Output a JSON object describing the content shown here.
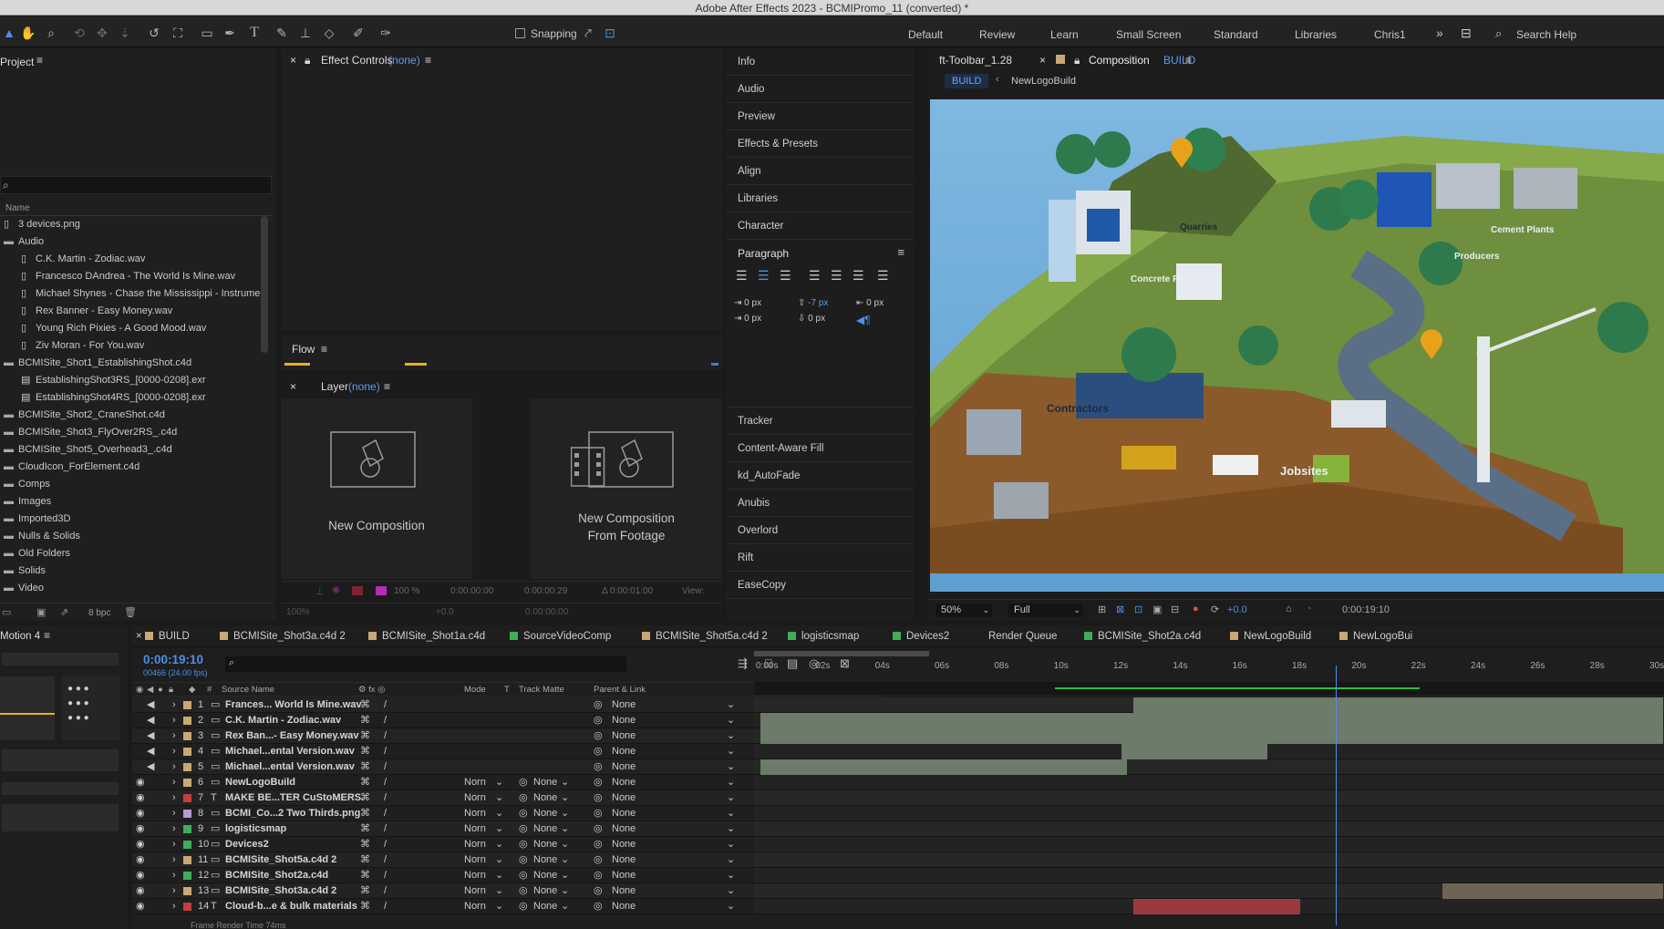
{
  "app": {
    "title": "Adobe After Effects 2023 - BCMIPromo_11 (converted) *"
  },
  "toolbar": {
    "snapping": "Snapping",
    "workspaces": [
      "Default",
      "Review",
      "Learn",
      "Small Screen",
      "Standard",
      "Libraries",
      "Chris1"
    ],
    "search_help": "Search Help",
    "tools": [
      "selection-arrow",
      "hand",
      "zoom",
      "orbit",
      "move",
      "dolly",
      "rotate",
      "anchor",
      "rectangle",
      "pen",
      "type",
      "brush",
      "clone-stamp",
      "eraser",
      "roto-brush",
      "puppet-pin"
    ]
  },
  "project": {
    "title": "Project",
    "name_header": "Name",
    "bpc": "8 bpc",
    "items": [
      {
        "label": "3 devices.png",
        "kind": "file",
        "indent": 0
      },
      {
        "label": "Audio",
        "kind": "folder",
        "indent": 0
      },
      {
        "label": "C.K. Martin - Zodiac.wav",
        "kind": "file",
        "indent": 1
      },
      {
        "label": "Francesco DAndrea - The World Is Mine.wav",
        "kind": "file",
        "indent": 1
      },
      {
        "label": "Michael Shynes - Chase the Mississippi - Instrumen",
        "kind": "file",
        "indent": 1
      },
      {
        "label": "Rex Banner - Easy Money.wav",
        "kind": "file",
        "indent": 1
      },
      {
        "label": "Young Rich Pixies - A Good Mood.wav",
        "kind": "file",
        "indent": 1
      },
      {
        "label": "Ziv Moran - For You.wav",
        "kind": "file",
        "indent": 1
      },
      {
        "label": "BCMISite_Shot1_EstablishingShot.c4d",
        "kind": "folder",
        "indent": 0
      },
      {
        "label": "EstablishingShot3RS_[0000-0208].exr",
        "kind": "seq",
        "indent": 1
      },
      {
        "label": "EstablishingShot4RS_[0000-0208].exr",
        "kind": "seq",
        "indent": 1
      },
      {
        "label": "BCMISite_Shot2_CraneShot.c4d",
        "kind": "folder",
        "indent": 0
      },
      {
        "label": "BCMISite_Shot3_FlyOver2RS_.c4d",
        "kind": "folder",
        "indent": 0
      },
      {
        "label": "BCMISite_Shot5_Overhead3_.c4d",
        "kind": "folder",
        "indent": 0
      },
      {
        "label": "CloudIcon_ForElement.c4d",
        "kind": "folder",
        "indent": 0
      },
      {
        "label": "Comps",
        "kind": "folder",
        "indent": 0
      },
      {
        "label": "Images",
        "kind": "folder",
        "indent": 0
      },
      {
        "label": "Imported3D",
        "kind": "folder",
        "indent": 0
      },
      {
        "label": "Nulls & Solids",
        "kind": "folder",
        "indent": 0
      },
      {
        "label": "Old Folders",
        "kind": "folder",
        "indent": 0
      },
      {
        "label": "Solids",
        "kind": "folder",
        "indent": 0
      },
      {
        "label": "Video",
        "kind": "folder",
        "indent": 0
      }
    ]
  },
  "effect_controls": {
    "title": "Effect Controls",
    "target": "(none)"
  },
  "flow": {
    "title": "Flow"
  },
  "layer_panel": {
    "title": "Layer",
    "target": "(none)",
    "new_comp": "New Composition",
    "new_comp_footage_1": "New Composition",
    "new_comp_footage_2": "From Footage",
    "zoom": "100 %",
    "time_a": "0:00:00:00",
    "time_b": "0:00:00:29",
    "delta": "Δ 0:00:01:00",
    "view": "View:",
    "zoom2": "100%",
    "exposure": "+0.0",
    "time_c": "0:00:00:00"
  },
  "right_panels": {
    "items_top": [
      "Info",
      "Audio",
      "Preview",
      "Effects & Presets",
      "Align",
      "Libraries",
      "Character"
    ],
    "paragraph": {
      "title": "Paragraph",
      "v1": "0 px",
      "v2": "-7 px",
      "v3": "0 px",
      "v4": "0 px",
      "v5": "0 px"
    },
    "items_bottom": [
      "Tracker",
      "Content-Aware Fill",
      "kd_AutoFade",
      "Anubis",
      "Overlord",
      "Rift",
      "EaseCopy"
    ]
  },
  "composition": {
    "tab_left": "ft-Toolbar_1.28",
    "tab_label": "Composition",
    "tab_name": "BUILD",
    "crumb_active": "BUILD",
    "crumb_next": "NewLogoBuild",
    "zoom": "50%",
    "resolution": "Full",
    "exposure": "+0.0",
    "time": "0:00:19:10",
    "scene_labels": [
      "Quarries",
      "Cement Plants",
      "Producers",
      "Concrete Plants",
      "Contractors",
      "Jobsites"
    ]
  },
  "timeline": {
    "tabs": [
      {
        "label": "BUILD",
        "color": "#c9a873"
      },
      {
        "label": "BCMISite_Shot3a.c4d 2",
        "color": "#c9a873"
      },
      {
        "label": "BCMISite_Shot1a.c4d",
        "color": "#c9a873"
      },
      {
        "label": "SourceVideoComp",
        "color": "#3fae5a"
      },
      {
        "label": "BCMISite_Shot5a.c4d 2",
        "color": "#c9a873"
      },
      {
        "label": "logisticsmap",
        "color": "#3fae5a"
      },
      {
        "label": "Devices2",
        "color": "#3fae5a"
      },
      {
        "label": "Render Queue",
        "color": ""
      },
      {
        "label": "BCMISite_Shot2a.c4d",
        "color": "#3fae5a"
      },
      {
        "label": "NewLogoBuild",
        "color": "#c9a873"
      },
      {
        "label": "NewLogoBui",
        "color": "#c9a873"
      }
    ],
    "motion_panel": "Motion 4",
    "timecode": "0:00:19:10",
    "frame_info": "00466 (24.00 fps)",
    "headers": {
      "source": "Source Name",
      "mode": "Mode",
      "t": "T",
      "matte": "Track Matte",
      "parent": "Parent & Link",
      "num": "#"
    },
    "ruler": [
      "0:00s",
      "02s",
      "04s",
      "06s",
      "08s",
      "10s",
      "12s",
      "14s",
      "16s",
      "18s",
      "20s",
      "22s",
      "24s",
      "26s",
      "28s",
      "30s"
    ],
    "playhead_seconds": 19.42,
    "duration_seconds": 30,
    "layers": [
      {
        "num": "1",
        "name": "Frances... World Is Mine.wav",
        "color": "#c9a873",
        "type": "audio",
        "mode": "",
        "matte": "",
        "parent": "None",
        "bar_start": 12.6,
        "bar_end": 30.4,
        "bar_color": "#6d7b6a"
      },
      {
        "num": "2",
        "name": "C.K. Martin - Zodiac.wav",
        "color": "#c9a873",
        "type": "audio",
        "mode": "",
        "matte": "",
        "parent": "None",
        "bar_start": 0.1,
        "bar_end": 30.4,
        "bar_color": "#6d7b6a"
      },
      {
        "num": "3",
        "name": "Rex Ban...- Easy Money.wav",
        "color": "#c9a873",
        "type": "audio",
        "mode": "",
        "matte": "",
        "parent": "None",
        "bar_start": 0.1,
        "bar_end": 30.4,
        "bar_color": "#6d7b6a"
      },
      {
        "num": "4",
        "name": "Michael...ental Version.wav",
        "color": "#c9a873",
        "type": "audio",
        "mode": "",
        "matte": "",
        "parent": "None",
        "bar_start": 12.2,
        "bar_end": 17.1,
        "bar_color": "#6d7b6a"
      },
      {
        "num": "5",
        "name": "Michael...ental Version.wav",
        "color": "#c9a873",
        "type": "audio",
        "mode": "",
        "matte": "",
        "parent": "None",
        "bar_start": 0.1,
        "bar_end": 12.4,
        "bar_color": "#6d7b6a"
      },
      {
        "num": "6",
        "name": "NewLogoBuild",
        "color": "#c9a873",
        "type": "comp",
        "mode": "Norn",
        "matte": "None",
        "parent": "None",
        "bar_start": 0,
        "bar_end": 0,
        "bar_color": ""
      },
      {
        "num": "7",
        "name": "MAKE BE...TER CuStoMERS.",
        "color": "#c04040",
        "type": "text",
        "mode": "Norn",
        "matte": "None",
        "parent": "None",
        "bar_start": 0,
        "bar_end": 0,
        "bar_color": ""
      },
      {
        "num": "8",
        "name": "BCMI_Co...2 Two Thirds.png",
        "color": "#b59ad2",
        "type": "image",
        "mode": "Norn",
        "matte": "None",
        "parent": "None",
        "bar_start": 0,
        "bar_end": 0,
        "bar_color": ""
      },
      {
        "num": "9",
        "name": "logisticsmap",
        "color": "#3fae5a",
        "type": "comp",
        "mode": "Norn",
        "matte": "None",
        "parent": "None",
        "bar_start": 0,
        "bar_end": 0,
        "bar_color": ""
      },
      {
        "num": "10",
        "name": "Devices2",
        "color": "#3fae5a",
        "type": "comp",
        "mode": "Norn",
        "matte": "None",
        "parent": "None",
        "bar_start": 0,
        "bar_end": 0,
        "bar_color": ""
      },
      {
        "num": "11",
        "name": "BCMISite_Shot5a.c4d 2",
        "color": "#c9a873",
        "type": "comp",
        "mode": "Norn",
        "matte": "None",
        "parent": "None",
        "bar_start": 0,
        "bar_end": 0,
        "bar_color": ""
      },
      {
        "num": "12",
        "name": "BCMISite_Shot2a.c4d",
        "color": "#3fae5a",
        "type": "comp",
        "mode": "Norn",
        "matte": "None",
        "parent": "None",
        "bar_start": 0,
        "bar_end": 0,
        "bar_color": ""
      },
      {
        "num": "13",
        "name": "BCMISite_Shot3a.c4d 2",
        "color": "#c9a873",
        "type": "comp",
        "mode": "Norn",
        "matte": "None",
        "parent": "None",
        "bar_start": 23.0,
        "bar_end": 30.4,
        "bar_color": "#6e6456"
      },
      {
        "num": "14",
        "name": "Cloud-b...e & bulk materials",
        "color": "#c04040",
        "type": "text",
        "mode": "Norn",
        "matte": "None",
        "parent": "None",
        "bar_start": 12.6,
        "bar_end": 18.2,
        "bar_color": "#9a3a3f"
      }
    ],
    "footer": "Frame Render Time  74ms"
  }
}
